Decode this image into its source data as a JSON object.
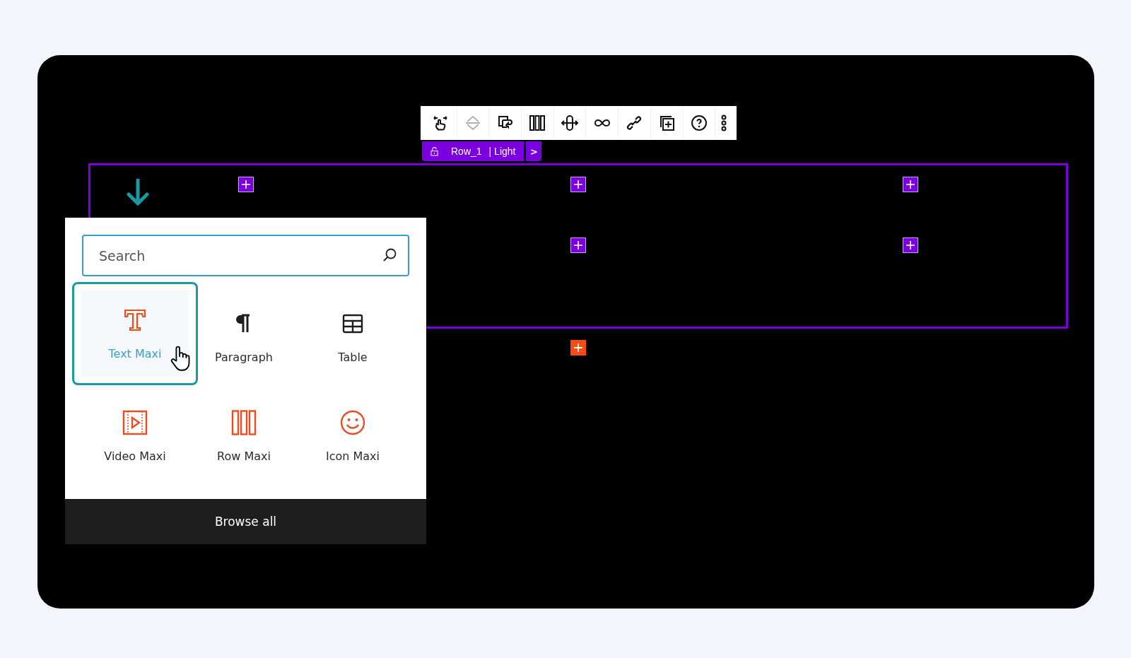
{
  "row_label": {
    "name": "Row_1",
    "style": "| Light",
    "next": ">"
  },
  "inserter": {
    "search": {
      "placeholder": "Search"
    },
    "blocks": [
      {
        "label": "Text Maxi",
        "selected": true
      },
      {
        "label": "Paragraph",
        "selected": false
      },
      {
        "label": "Table",
        "selected": false
      },
      {
        "label": "Video Maxi",
        "selected": false
      },
      {
        "label": "Row Maxi",
        "selected": false
      },
      {
        "label": "Icon Maxi",
        "selected": false
      }
    ],
    "browse_all": "Browse all"
  }
}
